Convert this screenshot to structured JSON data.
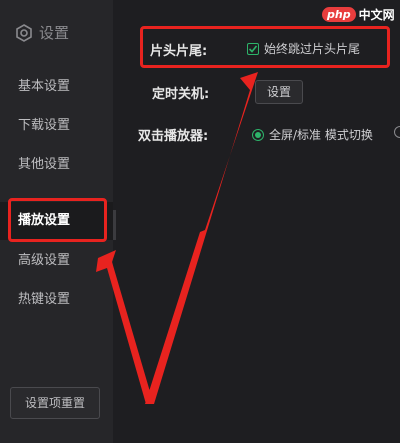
{
  "sidebar": {
    "title": "设置",
    "items": [
      {
        "label": "基本设置"
      },
      {
        "label": "下载设置"
      },
      {
        "label": "其他设置"
      },
      {
        "label": "播放设置"
      },
      {
        "label": "高级设置"
      },
      {
        "label": "热键设置"
      }
    ],
    "active_index": 3,
    "reset_label": "设置项重置"
  },
  "main": {
    "intro_outro": {
      "label": "片头片尾:",
      "checkbox_label": "始终跳过片头片尾",
      "checked": true
    },
    "shutdown": {
      "label": "定时关机:",
      "button_label": "设置"
    },
    "double_click": {
      "label": "双击播放器:",
      "option_label": "全屏/标准 模式切换",
      "selected": true
    }
  },
  "watermark": {
    "logo_text": "php",
    "site_text": "中文网"
  },
  "colors": {
    "accent": "#2db46a",
    "annotation": "#e8231f",
    "background": "#1e1e21",
    "sidebar": "#262629"
  }
}
